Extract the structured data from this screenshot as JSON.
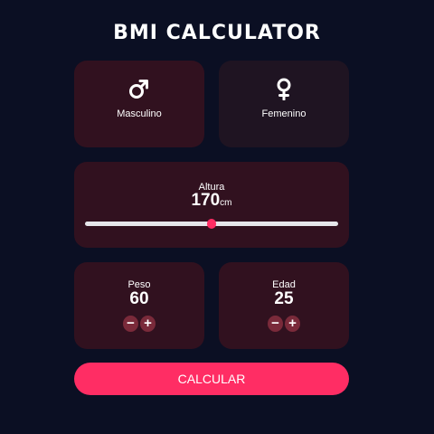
{
  "app": {
    "title": "BMI CALCULATOR"
  },
  "gender": {
    "male": {
      "label": "Masculino",
      "icon": "male-icon",
      "selected": true
    },
    "female": {
      "label": "Femenino",
      "icon": "female-icon",
      "selected": false
    }
  },
  "height": {
    "label": "Altura",
    "value": "170",
    "unit": "cm",
    "slider_fraction": 0.5
  },
  "weight": {
    "label": "Peso",
    "value": "60",
    "minus": "−",
    "plus": "+"
  },
  "age": {
    "label": "Edad",
    "value": "25",
    "minus": "−",
    "plus": "+"
  },
  "calculate": {
    "label": "CALCULAR"
  },
  "colors": {
    "background": "#0b0f23",
    "card_active": "#31111f",
    "card_inactive": "#1f1422",
    "accent": "#ff2d64",
    "counter_button": "#7a2a3a"
  }
}
